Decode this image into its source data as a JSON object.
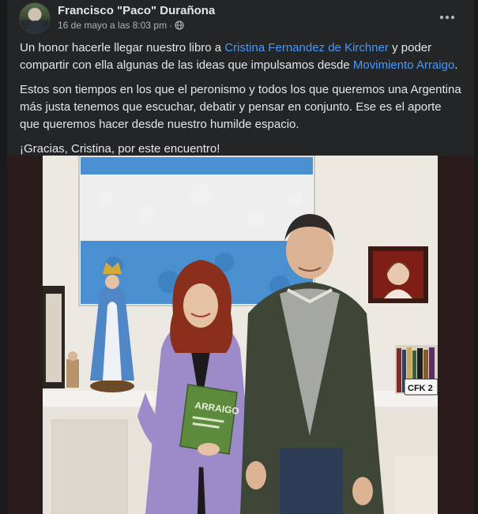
{
  "post": {
    "author": "Francisco \"Paco\" Durañona",
    "date": "16 de mayo a las 8:03 pm",
    "separator": "·",
    "privacy_icon": "globe-icon",
    "more_icon": "more-dots-icon",
    "p1": {
      "t1": "Un honor hacerle llegar nuestro libro a ",
      "link1": "Cristina Fernandez de Kirchner",
      "t2": " y poder compartir con ella algunas de las ideas que impulsamos desde ",
      "link2": "Movimiento Arraigo",
      "t3": "."
    },
    "p2": "Estos son tiempos en los que el peronismo y todos los que queremos una Argentina más justa tenemos que escuchar, debatir y pensar en conjunto. Ese es el aporte que queremos hacer desde nuestro humilde espacio.",
    "p3": "¡Gracias, Cristina, por este encuentro!"
  },
  "photo": {
    "book_title": "ARRAIGO",
    "plate_text": "CFK 2"
  },
  "colors": {
    "background": "#18191a",
    "card": "#242526",
    "text": "#e4e6eb",
    "secondary_text": "#b0b3b8",
    "link": "#4599ff"
  }
}
